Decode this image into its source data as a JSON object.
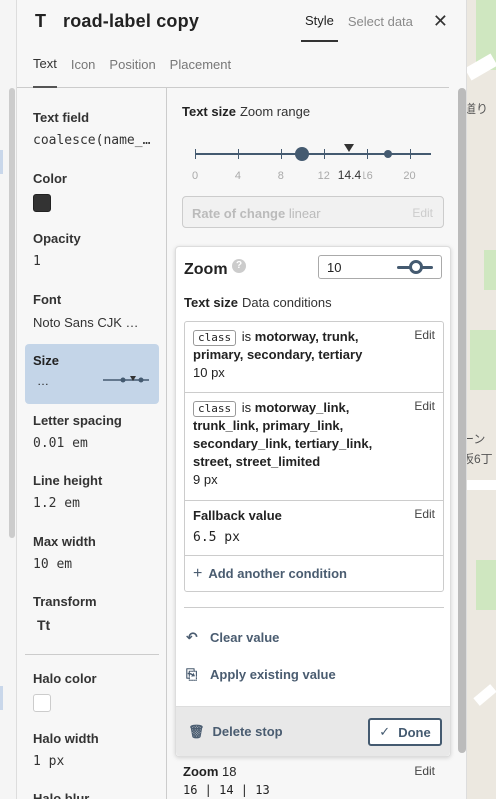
{
  "header": {
    "type_icon": "T",
    "title": "road-label copy",
    "tab_style": "Style",
    "tab_select_data": "Select data",
    "close_glyph": "✕"
  },
  "subtabs": [
    "Text",
    "Icon",
    "Position",
    "Placement"
  ],
  "properties": {
    "text_field": {
      "label": "Text field",
      "value": "coalesce(name_…"
    },
    "color": {
      "label": "Color",
      "swatch": "#333333"
    },
    "opacity": {
      "label": "Opacity",
      "value": "1"
    },
    "font": {
      "label": "Font",
      "value": "Noto Sans CJK …"
    },
    "size": {
      "label": "Size",
      "value": "…"
    },
    "letter_spacing": {
      "label": "Letter spacing",
      "value": "0.01 em"
    },
    "line_height": {
      "label": "Line height",
      "value": "1.2 em"
    },
    "max_width": {
      "label": "Max width",
      "value": "10 em"
    },
    "transform": {
      "label": "Transform",
      "value": "Tt"
    },
    "halo_color": {
      "label": "Halo color",
      "swatch": "#ffffff"
    },
    "halo_width": {
      "label": "Halo width",
      "value": "1 px"
    },
    "halo_blur": {
      "label": "Halo blur"
    }
  },
  "editor": {
    "heading": "Text size",
    "heading_sub": "Zoom range",
    "slider": {
      "ticks": [
        "0",
        "4",
        "8",
        "12",
        "16",
        "20"
      ],
      "current": "14.4",
      "min": 0,
      "max": 22,
      "stops": [
        10,
        18
      ],
      "current_value": 14.4
    },
    "rate_label": "Rate of change",
    "rate_value": "linear",
    "rate_edit": "Edit",
    "zoom_card": {
      "title": "Zoom",
      "help": "?",
      "zoom_value": "10",
      "cond_heading": "Text size",
      "cond_sub": "Data conditions",
      "conditions": [
        {
          "chip": "class",
          "is": "is",
          "values": "motorway, trunk, primary, secondary, tertiary",
          "result": "10 px",
          "edit": "Edit"
        },
        {
          "chip": "class",
          "is": "is",
          "values": "motorway_link, trunk_link, primary_link, secondary_link, tertiary_link, street, street_limited",
          "result": "9 px",
          "edit": "Edit"
        }
      ],
      "fallback": {
        "label": "Fallback value",
        "value": "6.5 px",
        "edit": "Edit"
      },
      "add_condition": "Add another condition",
      "clear_value": "Clear value",
      "apply_existing": "Apply existing value",
      "delete_stop": "Delete stop",
      "done": "Done"
    },
    "zoom18": {
      "label": "Zoom",
      "value": "18",
      "edit": "Edit",
      "row": "16 | 14 | 13"
    }
  },
  "map_labels": [
    "道り",
    "ーン",
    "坂6丁"
  ]
}
